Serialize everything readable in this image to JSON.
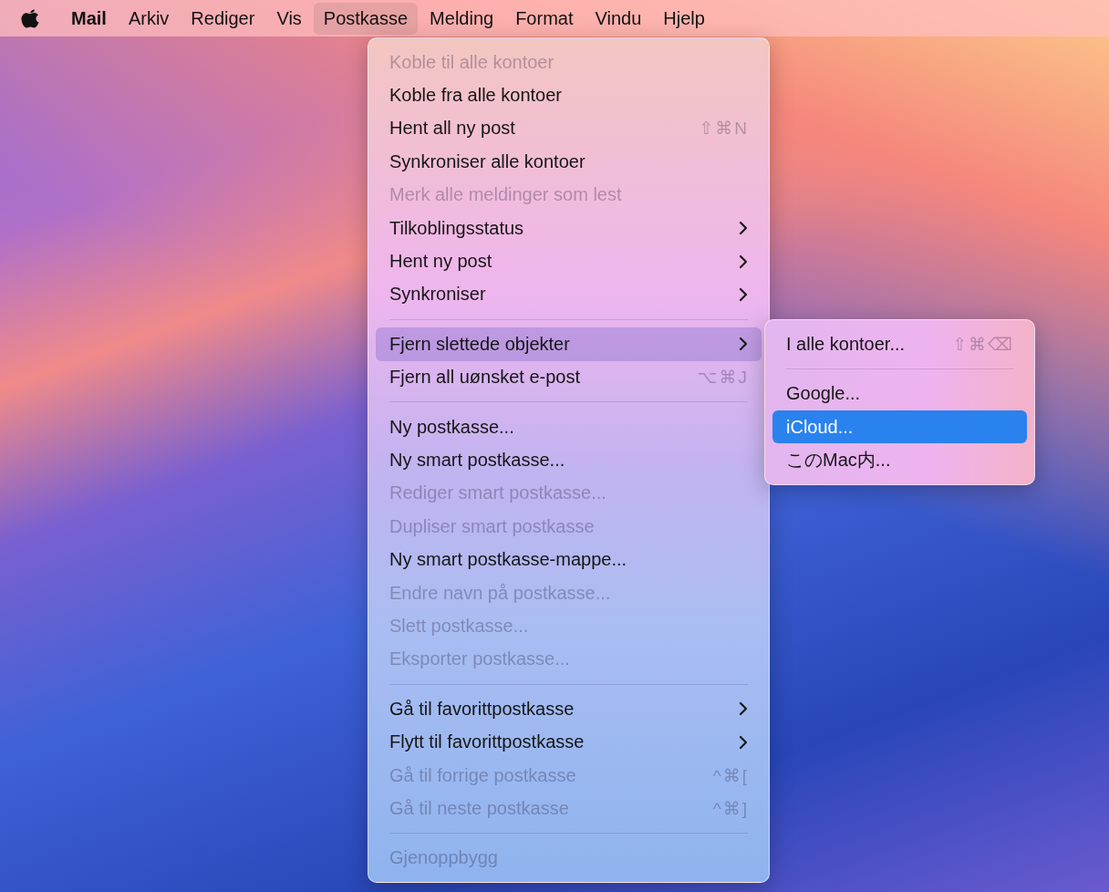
{
  "menubar": {
    "items": [
      {
        "label": "Mail",
        "kind": "app",
        "selected": false
      },
      {
        "label": "Arkiv",
        "kind": "menu",
        "selected": false
      },
      {
        "label": "Rediger",
        "kind": "menu",
        "selected": false
      },
      {
        "label": "Vis",
        "kind": "menu",
        "selected": false
      },
      {
        "label": "Postkasse",
        "kind": "menu",
        "selected": true
      },
      {
        "label": "Melding",
        "kind": "menu",
        "selected": false
      },
      {
        "label": "Format",
        "kind": "menu",
        "selected": false
      },
      {
        "label": "Vindu",
        "kind": "menu",
        "selected": false
      },
      {
        "label": "Hjelp",
        "kind": "menu",
        "selected": false
      }
    ]
  },
  "menu": {
    "items": [
      {
        "kind": "item",
        "label": "Koble til alle kontoer",
        "disabled": true,
        "selected": false
      },
      {
        "kind": "item",
        "label": "Koble fra alle kontoer",
        "disabled": false,
        "selected": false
      },
      {
        "kind": "item",
        "label": "Hent all ny post",
        "disabled": false,
        "selected": false,
        "shortcut": "⇧⌘N"
      },
      {
        "kind": "item",
        "label": "Synkroniser alle kontoer",
        "disabled": false,
        "selected": false
      },
      {
        "kind": "item",
        "label": "Merk alle meldinger som lest",
        "disabled": true,
        "selected": false
      },
      {
        "kind": "item",
        "label": "Tilkoblingsstatus",
        "disabled": false,
        "selected": false,
        "submenu": true
      },
      {
        "kind": "item",
        "label": "Hent ny post",
        "disabled": false,
        "selected": false,
        "submenu": true
      },
      {
        "kind": "item",
        "label": "Synkroniser",
        "disabled": false,
        "selected": false,
        "submenu": true
      },
      {
        "kind": "separator"
      },
      {
        "kind": "item",
        "label": "Fjern slettede objekter",
        "disabled": false,
        "selected": true,
        "submenu": true,
        "children": [
          {
            "kind": "item",
            "label": "I alle kontoer...",
            "disabled": false,
            "selected": false,
            "shortcut": "⇧⌘⌫"
          },
          {
            "kind": "separator"
          },
          {
            "kind": "item",
            "label": "Google...",
            "disabled": false,
            "selected": false
          },
          {
            "kind": "item",
            "label": "iCloud...",
            "disabled": false,
            "selected": true
          },
          {
            "kind": "item",
            "label": "このMac内...",
            "disabled": false,
            "selected": false
          }
        ]
      },
      {
        "kind": "item",
        "label": "Fjern all uønsket e-post",
        "disabled": false,
        "selected": false,
        "shortcut": "⌥⌘J"
      },
      {
        "kind": "separator"
      },
      {
        "kind": "item",
        "label": "Ny postkasse...",
        "disabled": false,
        "selected": false
      },
      {
        "kind": "item",
        "label": "Ny smart postkasse...",
        "disabled": false,
        "selected": false
      },
      {
        "kind": "item",
        "label": "Rediger smart postkasse...",
        "disabled": true,
        "selected": false
      },
      {
        "kind": "item",
        "label": "Dupliser smart postkasse",
        "disabled": true,
        "selected": false
      },
      {
        "kind": "item",
        "label": "Ny smart postkasse-mappe...",
        "disabled": false,
        "selected": false
      },
      {
        "kind": "item",
        "label": "Endre navn på postkasse...",
        "disabled": true,
        "selected": false
      },
      {
        "kind": "item",
        "label": "Slett postkasse...",
        "disabled": true,
        "selected": false
      },
      {
        "kind": "item",
        "label": "Eksporter postkasse...",
        "disabled": true,
        "selected": false
      },
      {
        "kind": "separator"
      },
      {
        "kind": "item",
        "label": "Gå til favorittpostkasse",
        "disabled": false,
        "selected": false,
        "submenu": true
      },
      {
        "kind": "item",
        "label": "Flytt til favorittpostkasse",
        "disabled": false,
        "selected": false,
        "submenu": true
      },
      {
        "kind": "item",
        "label": "Gå til forrige postkasse",
        "disabled": true,
        "selected": false,
        "shortcut": "^⌘["
      },
      {
        "kind": "item",
        "label": "Gå til neste postkasse",
        "disabled": true,
        "selected": false,
        "shortcut": "^⌘]"
      },
      {
        "kind": "separator"
      },
      {
        "kind": "item",
        "label": "Gjenoppbygg",
        "disabled": true,
        "selected": false
      }
    ]
  }
}
